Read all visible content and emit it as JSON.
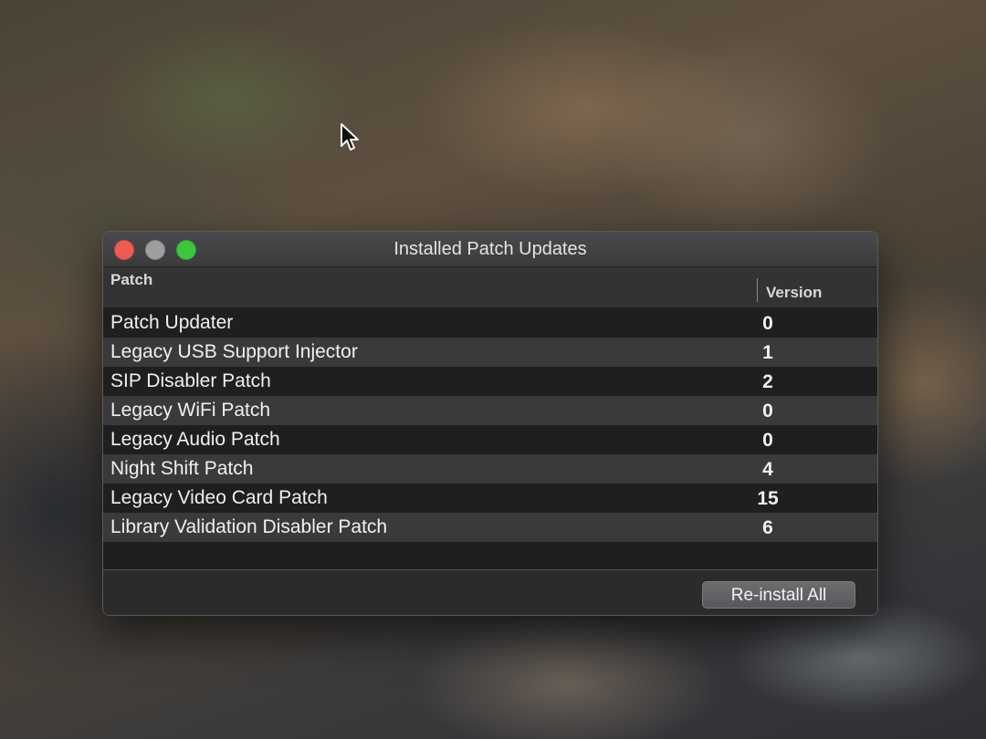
{
  "window": {
    "title": "Installed Patch Updates",
    "controls": [
      "close",
      "minimize",
      "zoom"
    ]
  },
  "table": {
    "columns": {
      "patch": "Patch",
      "version": "Version"
    },
    "rows": [
      {
        "name": "Patch Updater",
        "version": "0"
      },
      {
        "name": "Legacy USB Support Injector",
        "version": "1"
      },
      {
        "name": "SIP Disabler Patch",
        "version": "2"
      },
      {
        "name": "Legacy WiFi Patch",
        "version": "0"
      },
      {
        "name": "Legacy Audio Patch",
        "version": "0"
      },
      {
        "name": "Night Shift Patch",
        "version": "4"
      },
      {
        "name": "Legacy Video Card Patch",
        "version": "15"
      },
      {
        "name": "Library Validation Disabler Patch",
        "version": "6"
      }
    ]
  },
  "footer": {
    "reinstall_label": "Re-install All"
  },
  "colors": {
    "close": "#ee5b52",
    "minimize": "#9e9ea0",
    "zoom": "#3fc43f"
  }
}
